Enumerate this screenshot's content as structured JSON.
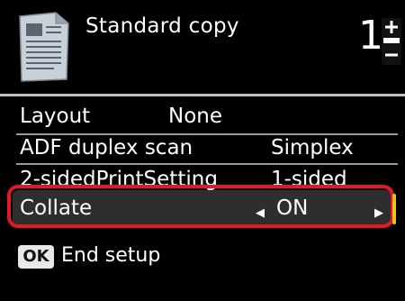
{
  "header": {
    "title": "Standard copy",
    "copies": "1"
  },
  "settings": [
    {
      "label": "Layout",
      "value": "None"
    },
    {
      "label": "ADF duplex scan",
      "value": "Simplex"
    },
    {
      "label": "2-sidedPrintSetting",
      "value": "1-sided"
    },
    {
      "label": "Collate",
      "value": "ON"
    }
  ],
  "footer": {
    "ok_label": "OK",
    "text": "End setup"
  },
  "colors": {
    "selection_ring": "#e0182a",
    "background": "#000000"
  },
  "icons": [
    "document-icon",
    "plus-minus-stepper-icon",
    "left-arrow-icon",
    "right-arrow-icon",
    "ok-button-icon"
  ]
}
